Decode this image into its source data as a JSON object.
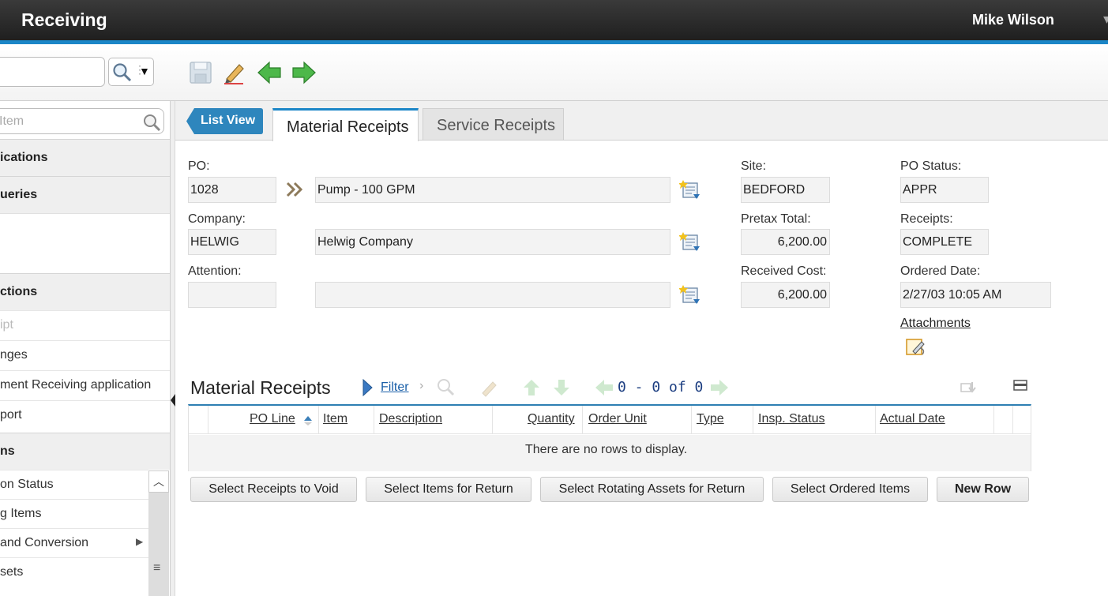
{
  "header": {
    "app_title": "Receiving",
    "user_name": "Mike Wilson"
  },
  "toolbar": {
    "quick_search_value": "",
    "icons": [
      "save-icon",
      "clear-changes-icon",
      "previous-record-icon",
      "next-record-icon"
    ]
  },
  "sidebar": {
    "find_placeholder": "Item",
    "sections": [
      {
        "label": "ications"
      },
      {
        "label": "ueries"
      },
      {
        "label": "ctions"
      }
    ],
    "actions": [
      {
        "label": "ipt",
        "disabled": true
      },
      {
        "label": "nges"
      },
      {
        "label": "ment Receiving application"
      },
      {
        "label": "port"
      }
    ],
    "more_section": "ns",
    "more_items": [
      {
        "label": "on Status"
      },
      {
        "label": "g Items"
      },
      {
        "label": "and Conversion",
        "has_submenu": true
      },
      {
        "label": "sets"
      }
    ]
  },
  "tabs": {
    "list_view": "List View",
    "items": [
      {
        "label": "Material Receipts",
        "active": true
      },
      {
        "label": "Service Receipts",
        "active": false
      }
    ]
  },
  "form": {
    "po_label": "PO:",
    "po_value": "1028",
    "po_desc": "Pump - 100 GPM",
    "company_label": "Company:",
    "company_value": "HELWIG",
    "company_desc": "Helwig Company",
    "attention_label": "Attention:",
    "attention_value": "",
    "attention_desc": "",
    "site_label": "Site:",
    "site_value": "BEDFORD",
    "pretax_label": "Pretax Total:",
    "pretax_value": "6,200.00",
    "received_cost_label": "Received Cost:",
    "received_cost_value": "6,200.00",
    "po_status_label": "PO Status:",
    "po_status_value": "APPR",
    "receipts_label": "Receipts:",
    "receipts_value": "COMPLETE",
    "ordered_date_label": "Ordered Date:",
    "ordered_date_value": "2/27/03 10:05 AM",
    "attachments_label": "Attachments"
  },
  "table": {
    "title": "Material Receipts",
    "filter_label": "Filter",
    "pager_text": "0 - 0 of 0",
    "columns": [
      "PO Line",
      "Item",
      "Description",
      "Quantity",
      "Order Unit",
      "Type",
      "Insp. Status",
      "Actual Date"
    ],
    "empty_message": "There are no rows to display."
  },
  "buttons": {
    "void": "Select Receipts to Void",
    "return_items": "Select Items for Return",
    "return_assets": "Select Rotating Assets for Return",
    "ordered_items": "Select Ordered Items",
    "new_row": "New Row"
  },
  "colors": {
    "accent": "#1b86c7",
    "header_bg": "#2a2a2a",
    "list_view_bg": "#2e86bd"
  }
}
